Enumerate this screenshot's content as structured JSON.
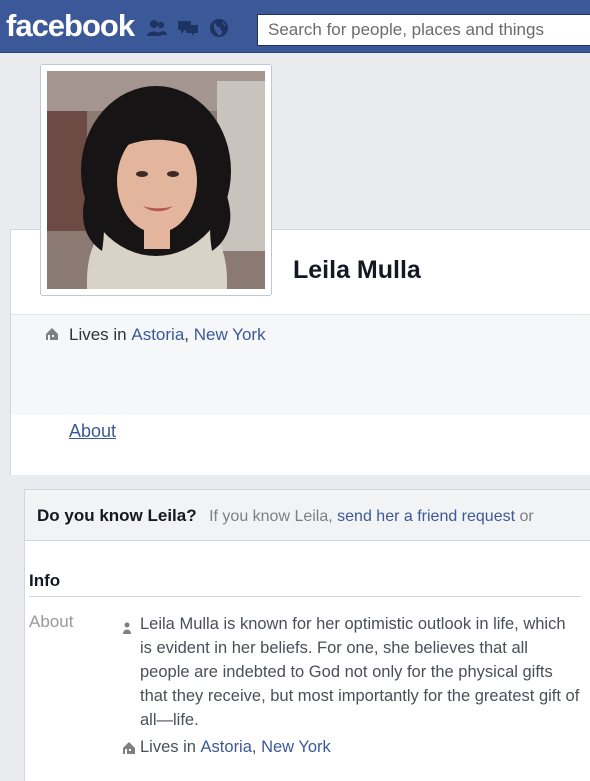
{
  "header": {
    "logo": "facebook",
    "search_placeholder": "Search for people, places and things",
    "icons": [
      "friend-requests-icon",
      "messages-icon",
      "notifications-globe-icon"
    ]
  },
  "profile": {
    "name": "Leila Mulla",
    "lives_prefix": "Lives in",
    "city": "Astoria",
    "separator": ", ",
    "state": "New York"
  },
  "nav": {
    "about": "About"
  },
  "know_box": {
    "question": "Do you know Leila?",
    "text": "If you know Leila,",
    "link": "send her a friend request",
    "tail": "or"
  },
  "info": {
    "title": "Info",
    "about_label": "About",
    "about_text": "Leila Mulla is known for her optimistic outlook in life, which is evident in her beliefs. For one, she believes that all people are indebted to God not only for the physical gifts that they receive, but most importantly for the greatest gift of all—life.",
    "lives_prefix": "Lives in",
    "city": "Astoria",
    "separator": ", ",
    "state": "New York"
  },
  "colors": {
    "brand": "#3b5998",
    "link": "#3b5998",
    "page_bg": "#e9ebee"
  }
}
